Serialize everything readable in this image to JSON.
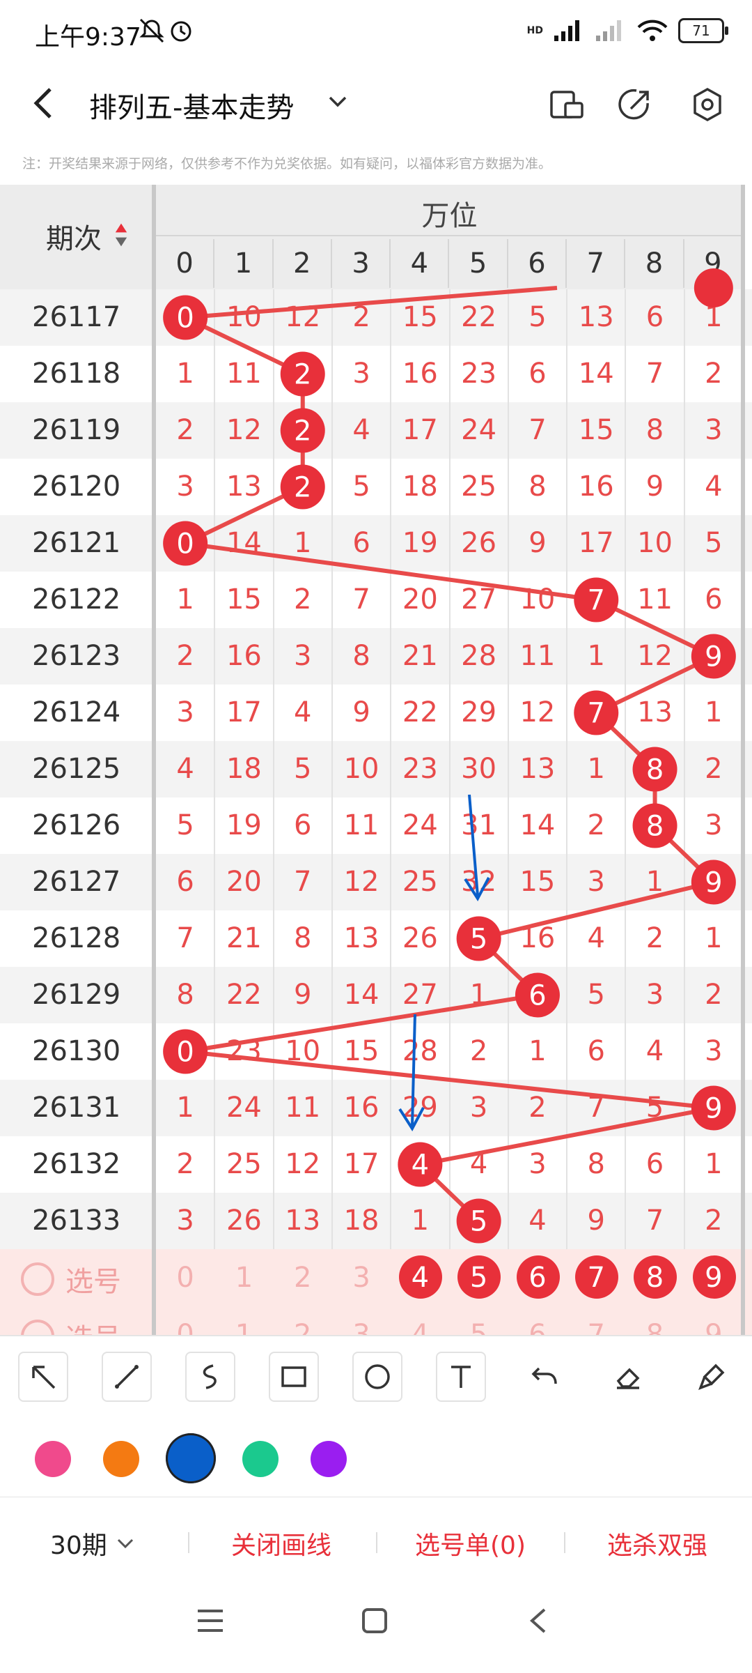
{
  "status": {
    "time": "上午9:37",
    "battery": "71",
    "signal": "HD"
  },
  "appbar": {
    "title": "排列五-基本走势"
  },
  "note": "注：开奖结果来源于网络，仅供参考不作为兑奖依据。如有疑问，以福体彩官方数据为准。",
  "table": {
    "period_header": "期次",
    "group_header": "万位",
    "digit_headers": [
      "0",
      "1",
      "2",
      "3",
      "4",
      "5",
      "6",
      "7",
      "8",
      "9"
    ],
    "rows": [
      {
        "period": "26117",
        "cells": [
          "0",
          "10",
          "12",
          "2",
          "15",
          "22",
          "5",
          "13",
          "6",
          "1"
        ],
        "hit": 0
      },
      {
        "period": "26118",
        "cells": [
          "1",
          "11",
          "2",
          "3",
          "16",
          "23",
          "6",
          "14",
          "7",
          "2"
        ],
        "hit": 2
      },
      {
        "period": "26119",
        "cells": [
          "2",
          "12",
          "2",
          "4",
          "17",
          "24",
          "7",
          "15",
          "8",
          "3"
        ],
        "hit": 2
      },
      {
        "period": "26120",
        "cells": [
          "3",
          "13",
          "2",
          "5",
          "18",
          "25",
          "8",
          "16",
          "9",
          "4"
        ],
        "hit": 2
      },
      {
        "period": "26121",
        "cells": [
          "0",
          "14",
          "1",
          "6",
          "19",
          "26",
          "9",
          "17",
          "10",
          "5"
        ],
        "hit": 0
      },
      {
        "period": "26122",
        "cells": [
          "1",
          "15",
          "2",
          "7",
          "20",
          "27",
          "10",
          "7",
          "11",
          "6"
        ],
        "hit": 7
      },
      {
        "period": "26123",
        "cells": [
          "2",
          "16",
          "3",
          "8",
          "21",
          "28",
          "11",
          "1",
          "12",
          "9"
        ],
        "hit": 9
      },
      {
        "period": "26124",
        "cells": [
          "3",
          "17",
          "4",
          "9",
          "22",
          "29",
          "12",
          "7",
          "13",
          "1"
        ],
        "hit": 7
      },
      {
        "period": "26125",
        "cells": [
          "4",
          "18",
          "5",
          "10",
          "23",
          "30",
          "13",
          "1",
          "8",
          "2"
        ],
        "hit": 8
      },
      {
        "period": "26126",
        "cells": [
          "5",
          "19",
          "6",
          "11",
          "24",
          "31",
          "14",
          "2",
          "8",
          "3"
        ],
        "hit": 8
      },
      {
        "period": "26127",
        "cells": [
          "6",
          "20",
          "7",
          "12",
          "25",
          "32",
          "15",
          "3",
          "1",
          "9"
        ],
        "hit": 9
      },
      {
        "period": "26128",
        "cells": [
          "7",
          "21",
          "8",
          "13",
          "26",
          "5",
          "16",
          "4",
          "2",
          "1"
        ],
        "hit": 5
      },
      {
        "period": "26129",
        "cells": [
          "8",
          "22",
          "9",
          "14",
          "27",
          "1",
          "6",
          "5",
          "3",
          "2"
        ],
        "hit": 6
      },
      {
        "period": "26130",
        "cells": [
          "0",
          "23",
          "10",
          "15",
          "28",
          "2",
          "1",
          "6",
          "4",
          "3"
        ],
        "hit": 0
      },
      {
        "period": "26131",
        "cells": [
          "1",
          "24",
          "11",
          "16",
          "29",
          "3",
          "2",
          "7",
          "5",
          "9"
        ],
        "hit": 9
      },
      {
        "period": "26132",
        "cells": [
          "2",
          "25",
          "12",
          "17",
          "4",
          "4",
          "3",
          "8",
          "6",
          "1"
        ],
        "hit": 4
      },
      {
        "period": "26133",
        "cells": [
          "3",
          "26",
          "13",
          "18",
          "1",
          "5",
          "4",
          "9",
          "7",
          "2"
        ],
        "hit": 5
      }
    ],
    "select_label": "选号",
    "select_label_2": "选号",
    "select_cells": [
      "0",
      "1",
      "2",
      "3",
      "4",
      "5",
      "6",
      "7",
      "8",
      "9"
    ],
    "select_on_from": 4
  },
  "palette": {
    "colors": [
      "#f04a8c",
      "#f47a12",
      "#0a5fc9",
      "#1bc98e",
      "#9a1ef0"
    ],
    "selected_index": 2
  },
  "bottom": {
    "periods": "30期",
    "close_lines": "关闭画线",
    "pick_list": "选号单(0)",
    "kill": "选杀双强"
  },
  "colors": {
    "accent_red": "#e8303a",
    "line_red": "#e84a4a",
    "pen_blue": "#0a5fc9"
  }
}
